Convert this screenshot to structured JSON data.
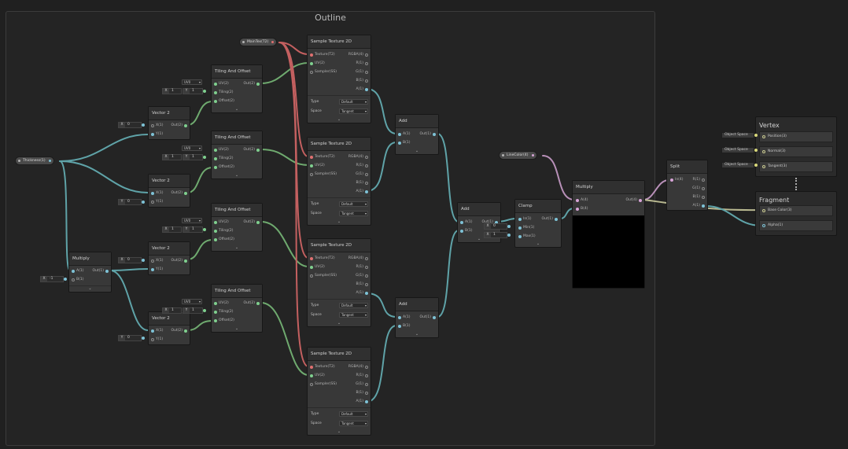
{
  "group": {
    "title": "Outline"
  },
  "properties": {
    "thickness": "Thickness(1)",
    "maintex": "MainTex(T2)",
    "outline_color": "LineColor(4)"
  },
  "tiling": [
    {
      "title": "Tiling And Offset",
      "uv_sel": "UV0",
      "tx": "1",
      "ty": "1",
      "in_uv": "UV(2)",
      "in_tiling": "Tiling(2)",
      "in_offset": "Offset(2)",
      "out": "Out(2)"
    },
    {
      "title": "Tiling And Offset",
      "uv_sel": "UV0",
      "tx": "1",
      "ty": "1",
      "in_uv": "UV(2)",
      "in_tiling": "Tiling(2)",
      "in_offset": "Offset(2)",
      "out": "Out(2)"
    },
    {
      "title": "Tiling And Offset",
      "uv_sel": "UV0",
      "tx": "1",
      "ty": "1",
      "in_uv": "UV(2)",
      "in_tiling": "Tiling(2)",
      "in_offset": "Offset(2)",
      "out": "Out(2)"
    },
    {
      "title": "Tiling And Offset",
      "uv_sel": "UV0",
      "tx": "1",
      "ty": "1",
      "in_uv": "UV(2)",
      "in_tiling": "Tiling(2)",
      "in_offset": "Offset(2)",
      "out": "Out(2)"
    }
  ],
  "vectors": [
    {
      "title": "Vector 2",
      "fixed_lab": "X",
      "fixed_val": "0",
      "in_x": "X(1)",
      "in_y": "Y(1)",
      "out": "Out(2)"
    },
    {
      "title": "Vector 2",
      "fixed_lab": "Y",
      "fixed_val": "0",
      "in_x": "X(1)",
      "in_y": "Y(1)",
      "out": "Out(2)"
    },
    {
      "title": "Vector 2",
      "fixed_lab": "X",
      "fixed_val": "0",
      "in_x": "X(1)",
      "in_y": "Y(1)",
      "out": "Out(2)"
    },
    {
      "title": "Vector 2",
      "fixed_lab": "Y",
      "fixed_val": "0",
      "in_x": "X(1)",
      "in_y": "Y(1)",
      "out": "Out(2)"
    }
  ],
  "multiply_small": {
    "title": "Multiply",
    "in_a": "A(1)",
    "in_b": "B(1)",
    "out": "Out(1)",
    "b_lab": "X",
    "b_val": "-1"
  },
  "samplers": [
    {
      "title": "Sample Texture 2D",
      "in_tex": "Texture(T2)",
      "in_uv": "UV(2)",
      "in_ss": "Sampler(SS)",
      "o_rgba": "RGBA(4)",
      "o_r": "R(1)",
      "o_g": "G(1)",
      "o_b": "B(1)",
      "o_a": "A(1)",
      "type_label": "Type",
      "type_val": "Default",
      "space_label": "Space",
      "space_val": "Tangent"
    },
    {
      "title": "Sample Texture 2D",
      "in_tex": "Texture(T2)",
      "in_uv": "UV(2)",
      "in_ss": "Sampler(SS)",
      "o_rgba": "RGBA(4)",
      "o_r": "R(1)",
      "o_g": "G(1)",
      "o_b": "B(1)",
      "o_a": "A(1)",
      "type_label": "Type",
      "type_val": "Default",
      "space_label": "Space",
      "space_val": "Tangent"
    },
    {
      "title": "Sample Texture 2D",
      "in_tex": "Texture(T2)",
      "in_uv": "UV(2)",
      "in_ss": "Sampler(SS)",
      "o_rgba": "RGBA(4)",
      "o_r": "R(1)",
      "o_g": "G(1)",
      "o_b": "B(1)",
      "o_a": "A(1)",
      "type_label": "Type",
      "type_val": "Default",
      "space_label": "Space",
      "space_val": "Tangent"
    },
    {
      "title": "Sample Texture 2D",
      "in_tex": "Texture(T2)",
      "in_uv": "UV(2)",
      "in_ss": "Sampler(SS)",
      "o_rgba": "RGBA(4)",
      "o_r": "R(1)",
      "o_g": "G(1)",
      "o_b": "B(1)",
      "o_a": "A(1)",
      "type_label": "Type",
      "type_val": "Default",
      "space_label": "Space",
      "space_val": "Tangent"
    }
  ],
  "adds": [
    {
      "title": "Add",
      "in_a": "A(1)",
      "in_b": "B(1)",
      "out": "Out(1)"
    },
    {
      "title": "Add",
      "in_a": "A(1)",
      "in_b": "B(1)",
      "out": "Out(1)"
    },
    {
      "title": "Add",
      "in_a": "A(1)",
      "in_b": "B(1)",
      "out": "Out(1)"
    }
  ],
  "clamp": {
    "title": "Clamp",
    "in": "In(1)",
    "min": "Min(1)",
    "max": "Max(1)",
    "out": "Out(1)",
    "min_lab": "X",
    "min_val": "0",
    "max_lab": "X",
    "max_val": "1"
  },
  "multiply_main": {
    "title": "Multiply",
    "in_a": "A(4)",
    "in_b": "B(4)",
    "out": "Out(4)"
  },
  "split": {
    "title": "Split",
    "in": "In(4)",
    "r": "R(1)",
    "g": "G(1)",
    "b": "B(1)",
    "a": "A(1)"
  },
  "vertex": {
    "title": "Vertex",
    "blocks": [
      {
        "label": "Position(3)",
        "space": "Object Space"
      },
      {
        "label": "Normal(3)",
        "space": "Object Space"
      },
      {
        "label": "Tangent(3)",
        "space": "Object Space"
      }
    ]
  },
  "fragment": {
    "title": "Fragment",
    "blocks": [
      {
        "label": "Base Color(3)"
      },
      {
        "label": "Alpha(1)"
      }
    ]
  },
  "colors": {
    "uv_wire": "#7fd08f",
    "float_wire": "#7ec2d6",
    "texture_wire": "#e07070",
    "vector4_wire": "#d8a4d8",
    "vector3_wire": "#d8d87a"
  }
}
